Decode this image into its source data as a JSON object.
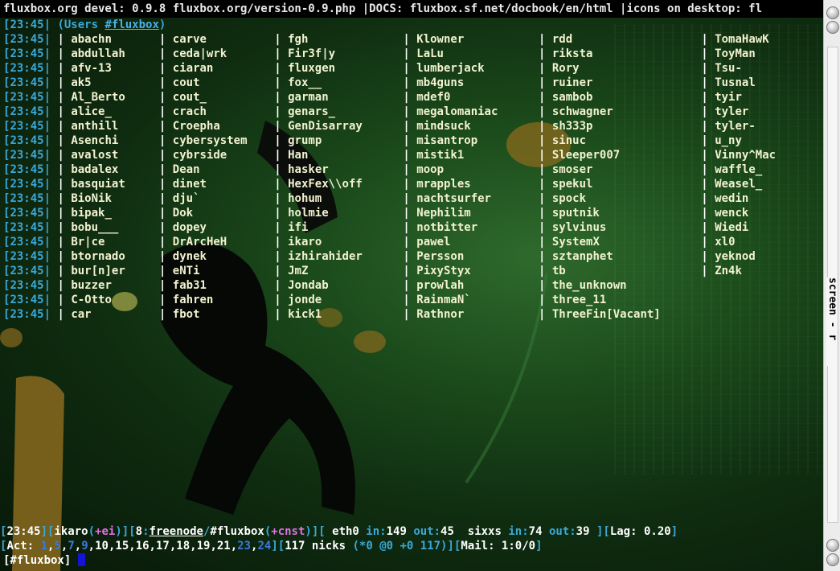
{
  "topic": "fluxbox.org devel: 0.9.8 fluxbox.org/version-0.9.php |DOCS: fluxbox.sf.net/docbook/en/html |icons on desktop: fl",
  "time": "23:45",
  "users_header": {
    "prefix": "(Users ",
    "channel": "#fluxbox",
    "suffix": ")"
  },
  "user_rows": [
    [
      "abachn",
      "carve",
      "fgh",
      "Klowner",
      "rdd",
      "TomaHawK"
    ],
    [
      "abdullah",
      "ceda|wrk",
      "Fir3f|y",
      "LaLu",
      "riksta",
      "ToyMan"
    ],
    [
      "afv-13",
      "ciaran",
      "fluxgen",
      "lumberjack",
      "Rory",
      "Tsu-"
    ],
    [
      "ak5",
      "cout",
      "fox__",
      "mb4guns",
      "ruiner",
      "Tusnal"
    ],
    [
      "Al_Berto",
      "cout_",
      "garman",
      "mdef0",
      "sambob",
      "tyir"
    ],
    [
      "alice_",
      "crach",
      "genars_",
      "megalomaniac",
      "schwagner",
      "tyler"
    ],
    [
      "anthill",
      "Croepha",
      "GenDisarray",
      "mindsuck",
      "sh333p",
      "tyler-"
    ],
    [
      "Asenchi",
      "cybersystem",
      "grump",
      "misantrop",
      "sinuc",
      "u_ny"
    ],
    [
      "avalost",
      "cybrside",
      "Han",
      "mistik1",
      "Sleeper007",
      "Vinny^Mac"
    ],
    [
      "badalex",
      "Dean",
      "hasker",
      "moop",
      "smoser",
      "waffle_"
    ],
    [
      "basquiat",
      "dinet",
      "HexFex\\\\off",
      "mrapples",
      "spekul",
      "Weasel_"
    ],
    [
      "BioNik",
      "dju`",
      "hohum",
      "nachtsurfer",
      "spock",
      "wedin"
    ],
    [
      "bipak_",
      "Dok",
      "holmie",
      "Nephilim",
      "sputnik",
      "wenck"
    ],
    [
      "bobu___",
      "dopey",
      "ifi",
      "notbitter",
      "sylvinus",
      "Wiedi"
    ],
    [
      "Br|ce",
      "DrArcHeH",
      "ikaro",
      "pawel",
      "SystemX",
      "xl0"
    ],
    [
      "btornado",
      "dynek",
      "izhirahider",
      "Persson",
      "sztanphet",
      "yeknod"
    ],
    [
      "bur[n]er",
      "eNTi",
      "JmZ",
      "PixyStyx",
      "tb",
      "Zn4k"
    ],
    [
      "buzzer",
      "fab31",
      "Jondab",
      "prowlah",
      "the_unknown",
      ""
    ],
    [
      "C-Otto",
      "fahren",
      "jonde",
      "RainmaN`",
      "three_11",
      ""
    ],
    [
      "car",
      "fbot",
      "kick1",
      "Rathnor",
      "ThreeFin[Vacant]",
      ""
    ]
  ],
  "status1": {
    "time": "23:45",
    "nick": "ikaro",
    "usermode": "+ei",
    "window": "8",
    "network": "freenode",
    "channel": "#fluxbox",
    "chanmode": "+cnst",
    "iface1": "eth0",
    "in_label": "in:",
    "out_label": "out:",
    "iface1_in": "149",
    "iface1_out": "45",
    "iface2": "sixxs",
    "iface2_in": "74",
    "iface2_out": "39",
    "lag": "Lag: 0.20"
  },
  "status2": {
    "act_label": "Act: ",
    "act_windows": [
      {
        "n": "1",
        "c": "blue"
      },
      {
        "n": "5",
        "c": "blue"
      },
      {
        "n": "7",
        "c": "blue"
      },
      {
        "n": "9",
        "c": "blue"
      },
      {
        "n": "10",
        "c": "white"
      },
      {
        "n": "15",
        "c": "white"
      },
      {
        "n": "16",
        "c": "white"
      },
      {
        "n": "17",
        "c": "white"
      },
      {
        "n": "18",
        "c": "white"
      },
      {
        "n": "19",
        "c": "white"
      },
      {
        "n": "21",
        "c": "white"
      },
      {
        "n": "23",
        "c": "blue"
      },
      {
        "n": "24",
        "c": "blue"
      }
    ],
    "nicks": "117 nicks",
    "nick_detail": "(*0 @0 +0 117)",
    "mail": "Mail: 1:0/0"
  },
  "input_prompt": "[#fluxbox]",
  "scrollbar_label": "screen - r",
  "colors": {
    "time": "#3aa8d8",
    "nick": "#f2f2d0",
    "cursor": "#1414d4",
    "scroll_bg": "#ececec"
  }
}
